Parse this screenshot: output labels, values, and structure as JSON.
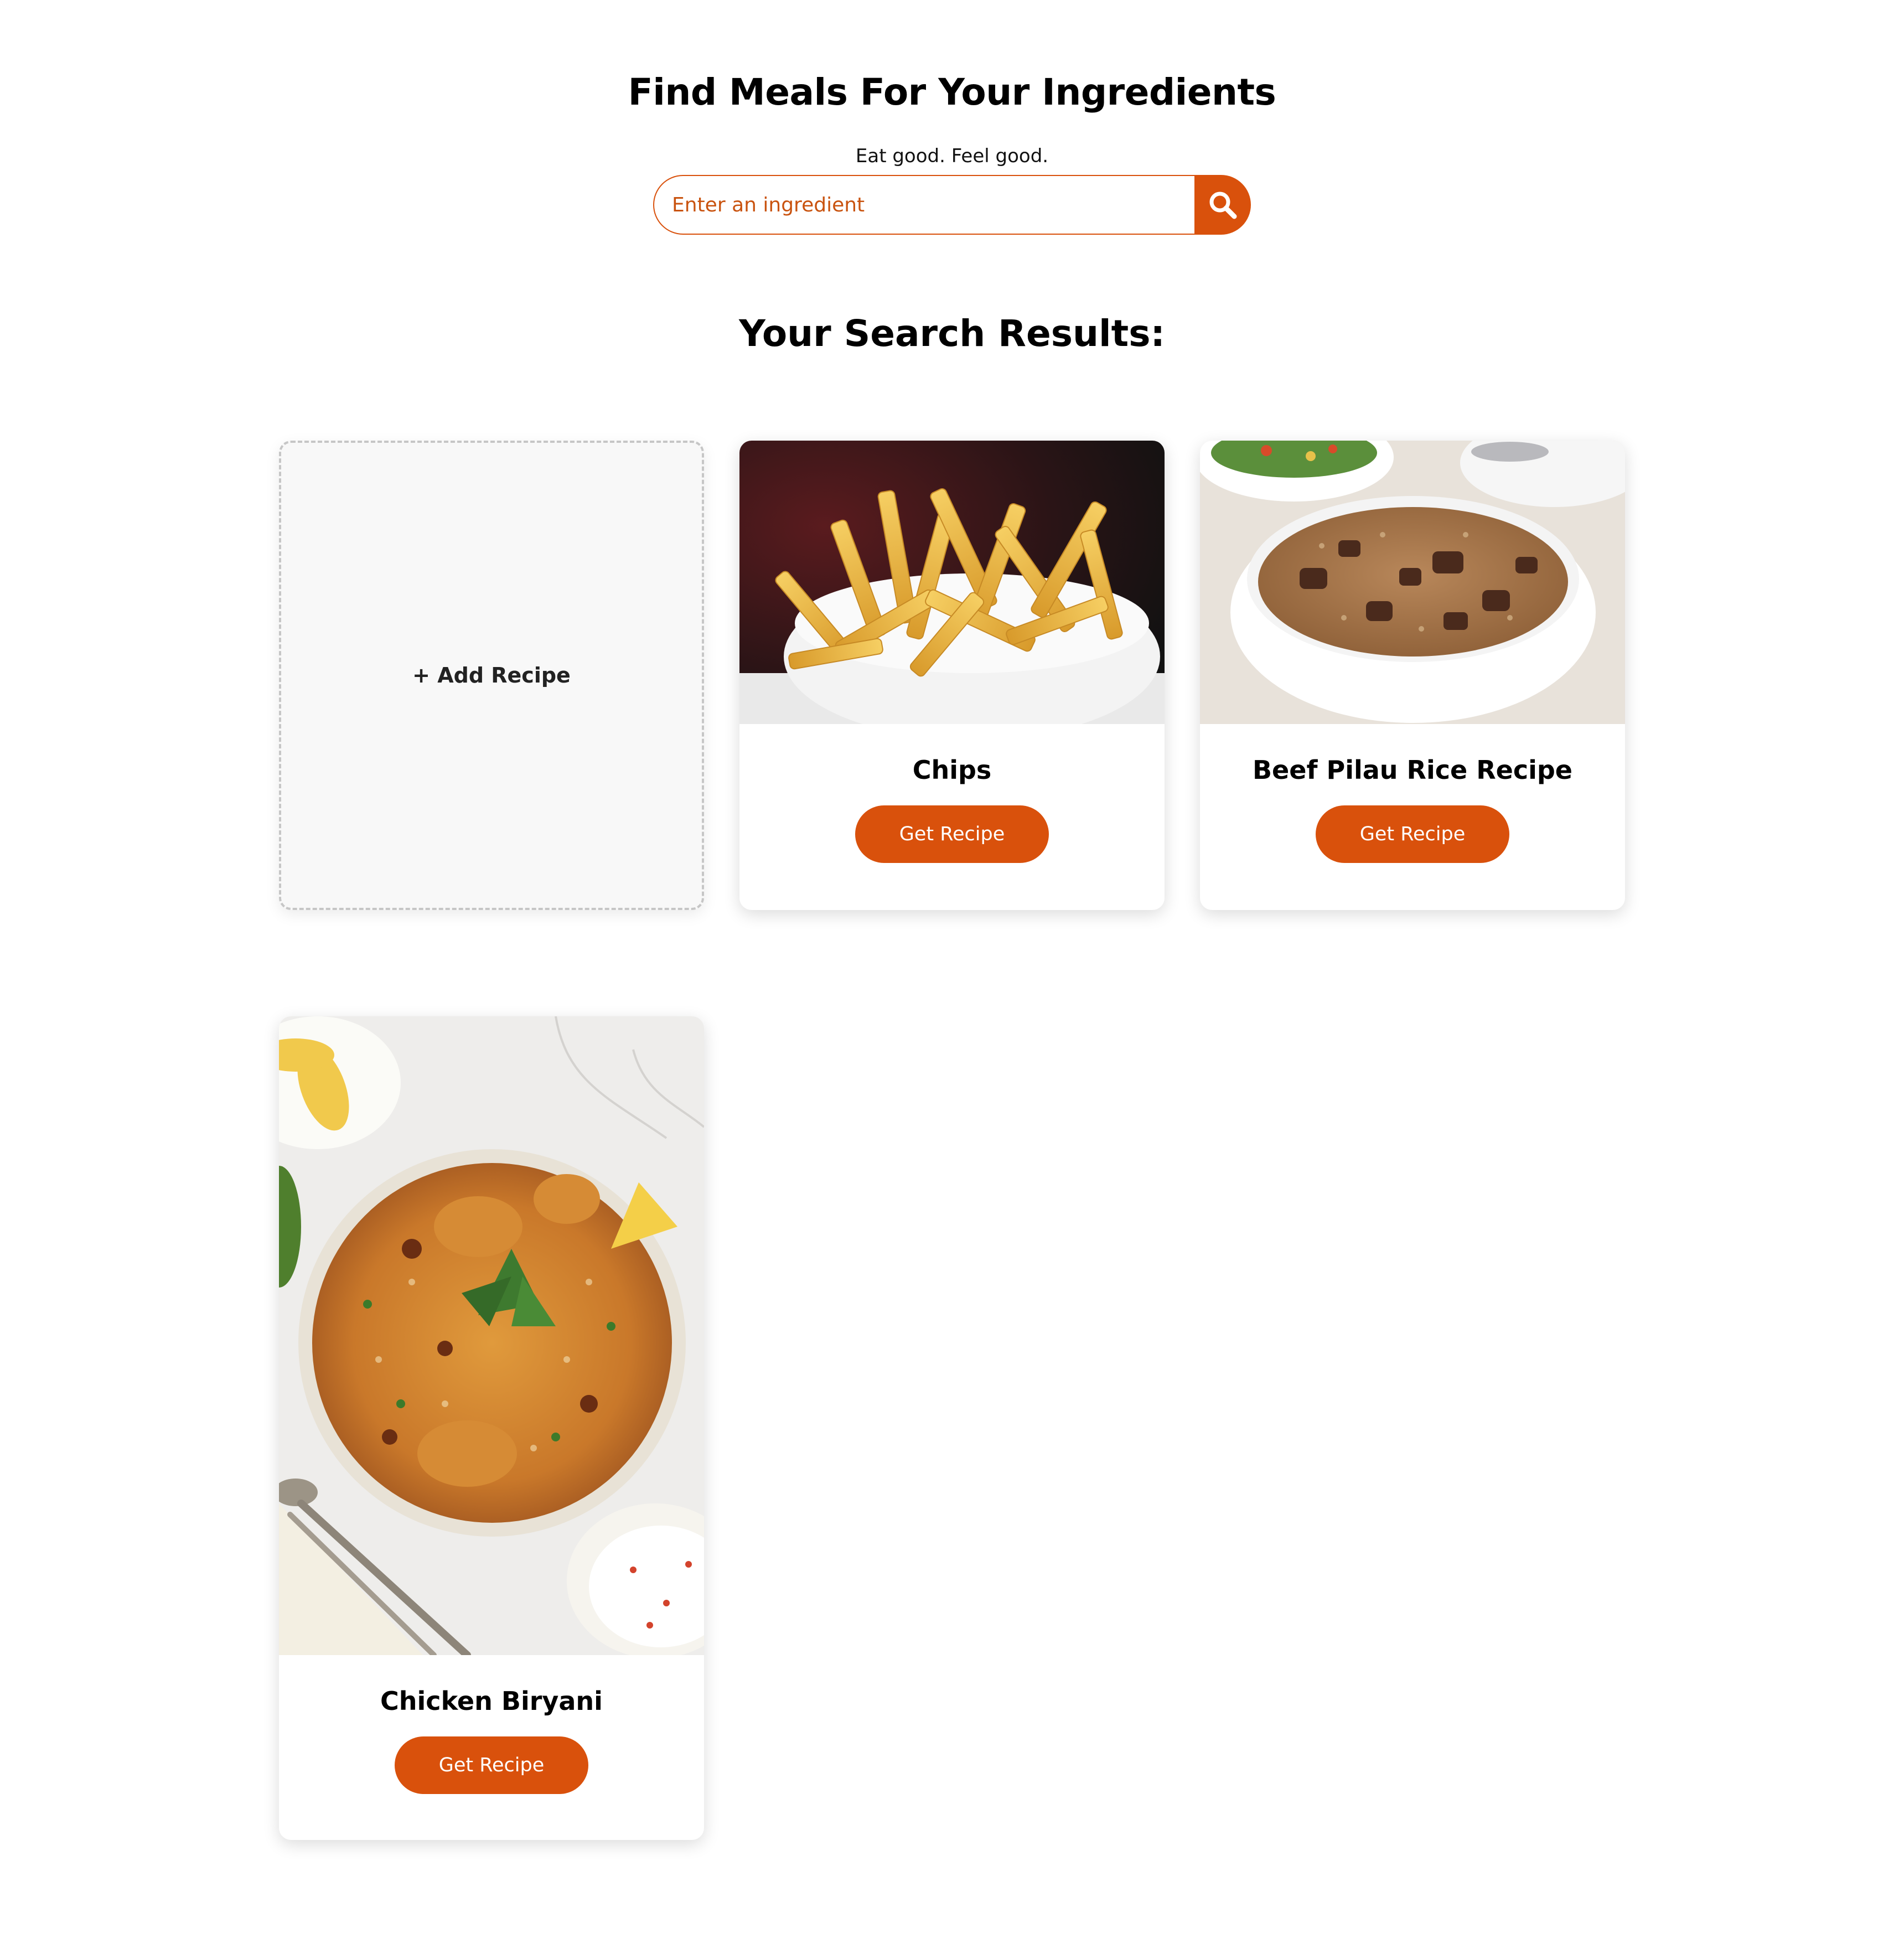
{
  "header": {
    "title": "Find Meals For Your Ingredients",
    "tagline": "Eat good. Feel good."
  },
  "search": {
    "placeholder": "Enter an ingredient",
    "button_icon": "search-icon"
  },
  "results": {
    "title": "Your Search Results:",
    "add_card_label": "+ Add Recipe",
    "items": [
      {
        "name": "Chips",
        "button_label": "Get Recipe",
        "image": "fries-photo"
      },
      {
        "name": "Beef Pilau Rice Recipe",
        "button_label": "Get Recipe",
        "image": "pilau-rice-photo"
      },
      {
        "name": "Chicken Biryani",
        "button_label": "Get Recipe",
        "image": "biryani-photo"
      }
    ]
  },
  "colors": {
    "accent": "#D9510C",
    "add_card_background": "#F8F8F8",
    "add_card_border": "#C6C6C6",
    "page_background": "#FFFFFF"
  }
}
